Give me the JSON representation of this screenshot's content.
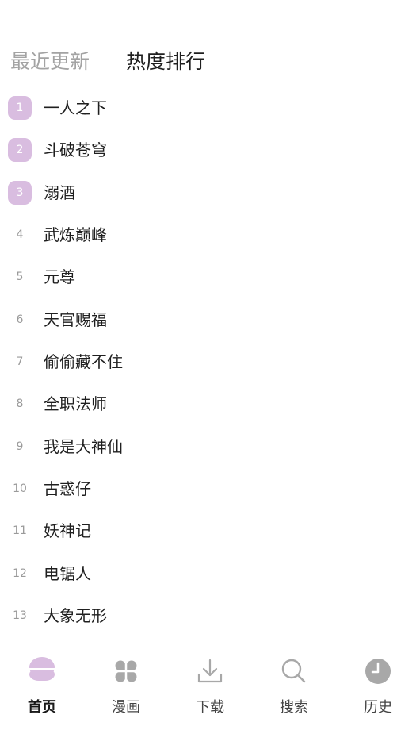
{
  "header": {
    "tabs": [
      {
        "label": "最近更新",
        "active": false
      },
      {
        "label": "热度排行",
        "active": true
      }
    ]
  },
  "ranking": [
    {
      "rank": "1",
      "title": "一人之下"
    },
    {
      "rank": "2",
      "title": "斗破苍穹"
    },
    {
      "rank": "3",
      "title": "溺酒"
    },
    {
      "rank": "4",
      "title": "武炼巅峰"
    },
    {
      "rank": "5",
      "title": "元尊"
    },
    {
      "rank": "6",
      "title": "天官赐福"
    },
    {
      "rank": "7",
      "title": "偷偷藏不住"
    },
    {
      "rank": "8",
      "title": "全职法师"
    },
    {
      "rank": "9",
      "title": "我是大神仙"
    },
    {
      "rank": "10",
      "title": "古惑仔"
    },
    {
      "rank": "11",
      "title": "妖神记"
    },
    {
      "rank": "12",
      "title": "电锯人"
    },
    {
      "rank": "13",
      "title": "大象无形"
    }
  ],
  "bottom_nav": [
    {
      "label": "首页",
      "icon": "home-icon",
      "active": true
    },
    {
      "label": "漫画",
      "icon": "grid-icon",
      "active": false
    },
    {
      "label": "下载",
      "icon": "download-icon",
      "active": false
    },
    {
      "label": "搜索",
      "icon": "search-icon",
      "active": false
    },
    {
      "label": "历史",
      "icon": "history-clock-icon",
      "active": false
    }
  ],
  "colors": {
    "accent": "#d9bde0",
    "inactive_icon": "#a8a8a8",
    "tab_inactive": "#a3a3a3",
    "text": "#1f1f1f"
  }
}
